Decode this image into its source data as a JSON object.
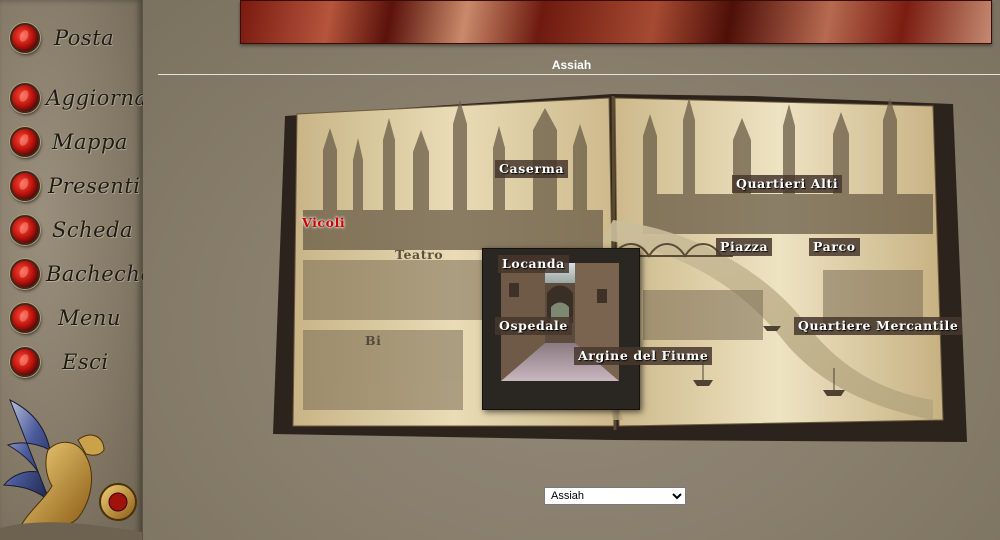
{
  "sidebar": {
    "items": [
      {
        "label": "Posta",
        "icon": "red-gem-bullet-icon"
      },
      {
        "label": "Aggiorna",
        "icon": "red-gem-bullet-icon"
      },
      {
        "label": "Mappa",
        "icon": "red-gem-bullet-icon"
      },
      {
        "label": "Presenti",
        "icon": "red-gem-bullet-icon"
      },
      {
        "label": "Scheda",
        "icon": "red-gem-bullet-icon"
      },
      {
        "label": "Bacheche",
        "icon": "red-gem-bullet-icon"
      },
      {
        "label": "Menu",
        "icon": "red-gem-bullet-icon"
      },
      {
        "label": "Esci",
        "icon": "red-gem-bullet-icon"
      }
    ]
  },
  "header": {
    "location_title": "Assiah"
  },
  "map": {
    "labels": {
      "caserma": "Caserma",
      "quartieri_alti": "Quartieri Alti",
      "vicoli": "Vicoli",
      "teatro": "Teatro",
      "locanda": "Locanda",
      "piazza": "Piazza",
      "parco": "Parco",
      "ospedale": "Ospedale",
      "quartiere_mercantile": "Quartiere Mercantile",
      "argine_del_fiume": "Argine del Fiume",
      "bi": "Bi"
    },
    "active_location": "Vicoli"
  },
  "location_select": {
    "selected": "Assiah"
  },
  "colors": {
    "background": "#8c8170",
    "accent_red": "#c0160e",
    "label_bg": "#463729"
  }
}
